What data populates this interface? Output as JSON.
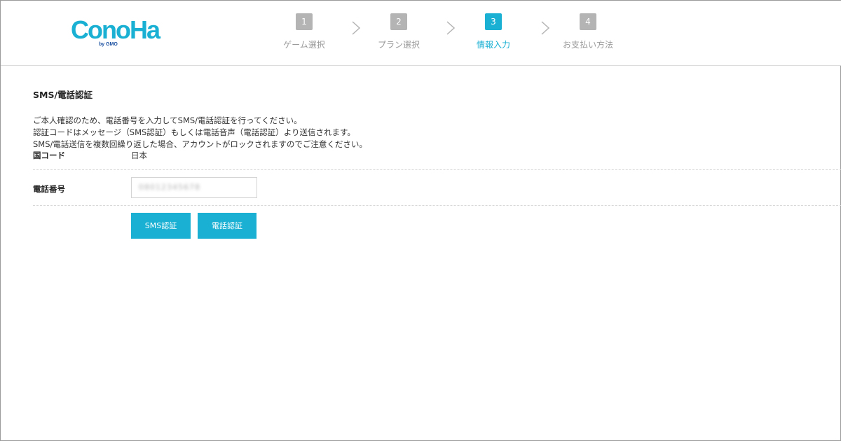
{
  "logo": {
    "text": "ConoHa",
    "sub": "by GMO",
    "color": "#19b0d3"
  },
  "steps": [
    {
      "num": "1",
      "label": "ゲーム選択",
      "active": false
    },
    {
      "num": "2",
      "label": "プラン選択",
      "active": false
    },
    {
      "num": "3",
      "label": "情報入力",
      "active": true
    },
    {
      "num": "4",
      "label": "お支払い方法",
      "active": false
    }
  ],
  "section": {
    "title": "SMS/電話認証",
    "desc": [
      "ご本人確認のため、電話番号を入力してSMS/電話認証を行ってください。",
      "認証コードはメッセージ（SMS認証）もしくは電話音声（電話認証）より送信されます。",
      "SMS/電話送信を複数回繰り返した場合、アカウントがロックされますのでご注意ください。"
    ]
  },
  "form": {
    "country_label": "国コード",
    "country_value": "日本",
    "phone_label": "電話番号",
    "phone_value": "08012345678"
  },
  "buttons": {
    "sms": "SMS認証",
    "phone": "電話認証"
  },
  "colors": {
    "accent": "#19b0d3",
    "inactive": "#b4b4b4"
  }
}
